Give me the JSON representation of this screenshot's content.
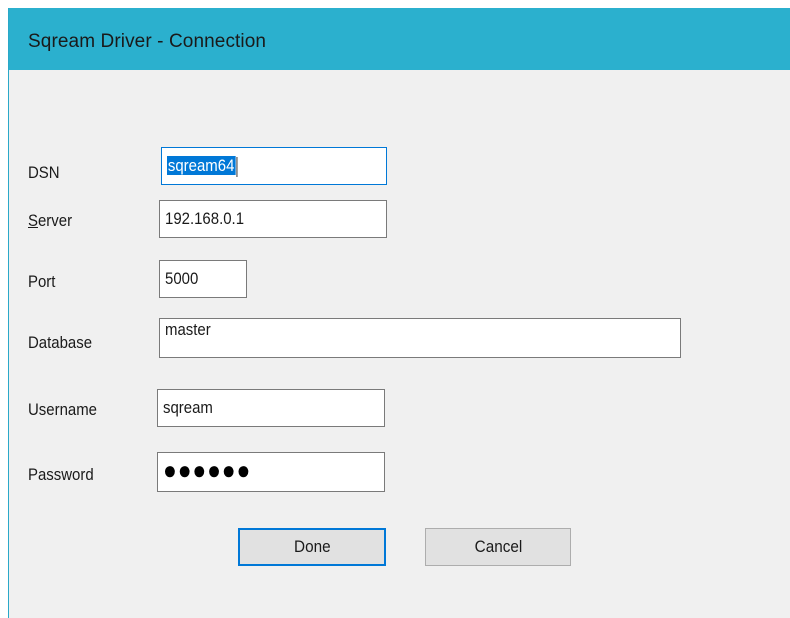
{
  "window": {
    "title": "Sqream Driver - Connection"
  },
  "form": {
    "dsn": {
      "label": "DSN",
      "value": "sqream64"
    },
    "server": {
      "label_hotkey": "S",
      "label_rest": "erver",
      "value": "192.168.0.1"
    },
    "port": {
      "label": "Port",
      "value": "5000"
    },
    "database": {
      "label": "Database",
      "value": "master"
    },
    "username": {
      "label": "Username",
      "value": "sqream"
    },
    "password": {
      "label": "Password",
      "value": "●●●●●●"
    }
  },
  "buttons": {
    "done": "Done",
    "cancel": "Cancel"
  },
  "colors": {
    "titlebar": "#2bb0ce",
    "focus": "#0078d7",
    "dialog_bg": "#f0f0f0"
  }
}
